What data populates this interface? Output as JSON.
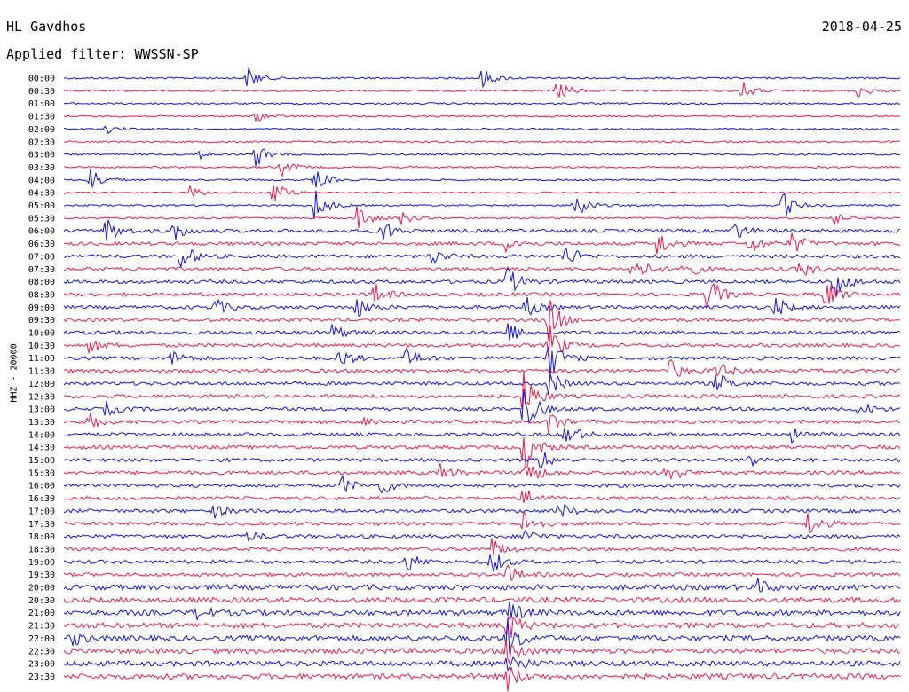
{
  "header": {
    "station": "HL Gavdhos",
    "filter": "Applied filter: WWSSN-SP",
    "date": "2018-04-25",
    "channel": "HHZ - 20000"
  },
  "colors": {
    "a": "#1010e8",
    "b": "#f0184a"
  },
  "chart_data": {
    "type": "line",
    "title": "HL Gavdhos",
    "subtitle": "Applied filter: WWSSN-SP",
    "ylabel": "HHZ - 20000",
    "row_labels": [
      "00:00",
      "00:30",
      "01:00",
      "01:30",
      "02:00",
      "02:30",
      "03:00",
      "03:30",
      "04:00",
      "04:30",
      "05:00",
      "05:30",
      "06:00",
      "06:30",
      "07:00",
      "07:30",
      "08:00",
      "08:30",
      "09:00",
      "09:30",
      "10:00",
      "10:30",
      "11:00",
      "11:30",
      "12:00",
      "12:30",
      "13:00",
      "13:30",
      "14:00",
      "14:30",
      "15:00",
      "15:30",
      "16:00",
      "16:30",
      "17:00",
      "17:30",
      "18:00",
      "18:30",
      "19:00",
      "19:30",
      "20:00",
      "20:30",
      "21:00",
      "21:30",
      "22:00",
      "22:30",
      "23:00",
      "23:30"
    ],
    "series_colors": [
      "#1010e8",
      "#f0184a"
    ],
    "noise_level": [
      1,
      1,
      1,
      1,
      1,
      1,
      1,
      1,
      1,
      1,
      1,
      1,
      2,
      2,
      2,
      2,
      2,
      2,
      2,
      2,
      2,
      2,
      2,
      2,
      2,
      2,
      2,
      2,
      2,
      2,
      2,
      2,
      2,
      2,
      2,
      2,
      2,
      2,
      2,
      2,
      3,
      3,
      3,
      3,
      3,
      3,
      3,
      3
    ],
    "events": [
      {
        "row": 0,
        "t": 0.22,
        "amp": 14
      },
      {
        "row": 0,
        "t": 0.5,
        "amp": 12
      },
      {
        "row": 1,
        "t": 0.59,
        "amp": 14
      },
      {
        "row": 1,
        "t": 0.81,
        "amp": 12
      },
      {
        "row": 1,
        "t": 0.95,
        "amp": 8
      },
      {
        "row": 3,
        "t": 0.23,
        "amp": 6
      },
      {
        "row": 4,
        "t": 0.05,
        "amp": 5
      },
      {
        "row": 6,
        "t": 0.23,
        "amp": 16
      },
      {
        "row": 6,
        "t": 0.16,
        "amp": 5
      },
      {
        "row": 7,
        "t": 0.26,
        "amp": 10
      },
      {
        "row": 8,
        "t": 0.03,
        "amp": 18
      },
      {
        "row": 8,
        "t": 0.3,
        "amp": 12
      },
      {
        "row": 9,
        "t": 0.25,
        "amp": 14
      },
      {
        "row": 9,
        "t": 0.15,
        "amp": 8
      },
      {
        "row": 10,
        "t": 0.3,
        "amp": 20
      },
      {
        "row": 10,
        "t": 0.61,
        "amp": 22
      },
      {
        "row": 10,
        "t": 0.86,
        "amp": 16
      },
      {
        "row": 11,
        "t": 0.35,
        "amp": 18
      },
      {
        "row": 11,
        "t": 0.4,
        "amp": 10
      },
      {
        "row": 11,
        "t": 0.92,
        "amp": 8
      },
      {
        "row": 12,
        "t": 0.05,
        "amp": 16
      },
      {
        "row": 12,
        "t": 0.13,
        "amp": 12
      },
      {
        "row": 12,
        "t": 0.38,
        "amp": 14
      },
      {
        "row": 12,
        "t": 0.8,
        "amp": 12
      },
      {
        "row": 13,
        "t": 0.53,
        "amp": 12
      },
      {
        "row": 13,
        "t": 0.71,
        "amp": 16
      },
      {
        "row": 13,
        "t": 0.82,
        "amp": 12
      },
      {
        "row": 13,
        "t": 0.87,
        "amp": 14
      },
      {
        "row": 14,
        "t": 0.14,
        "amp": 16
      },
      {
        "row": 14,
        "t": 0.6,
        "amp": 14
      },
      {
        "row": 14,
        "t": 0.44,
        "amp": 10
      },
      {
        "row": 15,
        "t": 0.68,
        "amp": 18
      },
      {
        "row": 15,
        "t": 0.74,
        "amp": 14
      },
      {
        "row": 15,
        "t": 0.88,
        "amp": 10
      },
      {
        "row": 16,
        "t": 0.92,
        "amp": 22
      },
      {
        "row": 16,
        "t": 0.53,
        "amp": 18
      },
      {
        "row": 17,
        "t": 0.37,
        "amp": 14
      },
      {
        "row": 17,
        "t": 0.77,
        "amp": 22
      },
      {
        "row": 17,
        "t": 0.91,
        "amp": 18
      },
      {
        "row": 18,
        "t": 0.18,
        "amp": 10
      },
      {
        "row": 18,
        "t": 0.35,
        "amp": 12
      },
      {
        "row": 18,
        "t": 0.55,
        "amp": 14
      },
      {
        "row": 18,
        "t": 0.85,
        "amp": 12
      },
      {
        "row": 19,
        "t": 0.58,
        "amp": 26
      },
      {
        "row": 20,
        "t": 0.32,
        "amp": 10
      },
      {
        "row": 20,
        "t": 0.53,
        "amp": 14
      },
      {
        "row": 21,
        "t": 0.58,
        "amp": 24
      },
      {
        "row": 21,
        "t": 0.03,
        "amp": 8
      },
      {
        "row": 22,
        "t": 0.13,
        "amp": 10
      },
      {
        "row": 22,
        "t": 0.33,
        "amp": 12
      },
      {
        "row": 22,
        "t": 0.41,
        "amp": 12
      },
      {
        "row": 22,
        "t": 0.58,
        "amp": 26
      },
      {
        "row": 23,
        "t": 0.72,
        "amp": 18
      },
      {
        "row": 23,
        "t": 0.78,
        "amp": 12
      },
      {
        "row": 24,
        "t": 0.58,
        "amp": 16
      },
      {
        "row": 24,
        "t": 0.78,
        "amp": 14
      },
      {
        "row": 25,
        "t": 0.55,
        "amp": 30
      },
      {
        "row": 26,
        "t": 0.05,
        "amp": 8
      },
      {
        "row": 26,
        "t": 0.55,
        "amp": 30
      },
      {
        "row": 26,
        "t": 0.95,
        "amp": 10
      },
      {
        "row": 27,
        "t": 0.03,
        "amp": 10
      },
      {
        "row": 27,
        "t": 0.36,
        "amp": 6
      },
      {
        "row": 27,
        "t": 0.58,
        "amp": 16
      },
      {
        "row": 28,
        "t": 0.6,
        "amp": 16
      },
      {
        "row": 28,
        "t": 0.87,
        "amp": 8
      },
      {
        "row": 29,
        "t": 0.55,
        "amp": 30
      },
      {
        "row": 30,
        "t": 0.57,
        "amp": 12
      },
      {
        "row": 30,
        "t": 0.82,
        "amp": 8
      },
      {
        "row": 31,
        "t": 0.45,
        "amp": 10
      },
      {
        "row": 31,
        "t": 0.55,
        "amp": 22
      },
      {
        "row": 31,
        "t": 0.72,
        "amp": 14
      },
      {
        "row": 32,
        "t": 0.33,
        "amp": 12
      },
      {
        "row": 32,
        "t": 0.38,
        "amp": 10
      },
      {
        "row": 33,
        "t": 0.55,
        "amp": 14
      },
      {
        "row": 34,
        "t": 0.18,
        "amp": 8
      },
      {
        "row": 34,
        "t": 0.59,
        "amp": 12
      },
      {
        "row": 35,
        "t": 0.55,
        "amp": 16
      },
      {
        "row": 35,
        "t": 0.89,
        "amp": 16
      },
      {
        "row": 36,
        "t": 0.22,
        "amp": 6
      },
      {
        "row": 36,
        "t": 0.55,
        "amp": 10
      },
      {
        "row": 37,
        "t": 0.51,
        "amp": 14
      },
      {
        "row": 38,
        "t": 0.41,
        "amp": 12
      },
      {
        "row": 38,
        "t": 0.51,
        "amp": 16
      },
      {
        "row": 39,
        "t": 0.53,
        "amp": 10
      },
      {
        "row": 40,
        "t": 0.83,
        "amp": 8
      },
      {
        "row": 42,
        "t": 0.53,
        "amp": 16
      },
      {
        "row": 42,
        "t": 0.16,
        "amp": 8
      },
      {
        "row": 43,
        "t": 0.53,
        "amp": 18
      },
      {
        "row": 44,
        "t": 0.53,
        "amp": 22
      },
      {
        "row": 44,
        "t": 0.01,
        "amp": 8
      },
      {
        "row": 45,
        "t": 0.53,
        "amp": 22
      },
      {
        "row": 46,
        "t": 0.53,
        "amp": 16
      },
      {
        "row": 47,
        "t": 0.53,
        "amp": 16
      }
    ]
  }
}
